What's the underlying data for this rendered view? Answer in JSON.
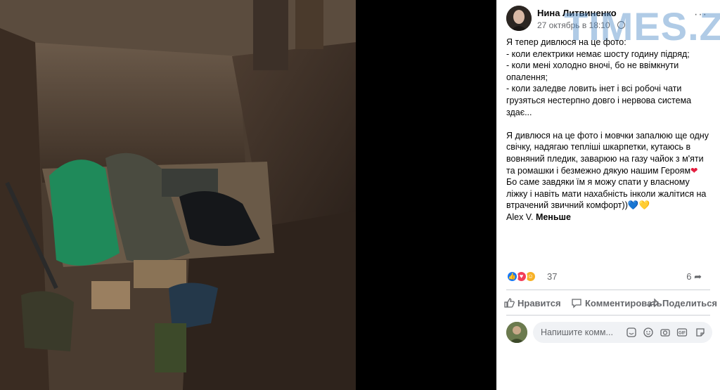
{
  "post": {
    "author": "Нина Литвиненко",
    "timestamp": "27 октябрь в 18:10",
    "watermark": "TIMES.ZT",
    "more_label": "···",
    "text_lines": [
      "Я тепер дивлюся на це фото:",
      "- коли електрики немає шосту годину підряд;",
      "- коли мені холодно вночі, бо не ввімкнути опалення;",
      "- коли заледве ловить інет і всі робочі чати грузяться нестерпно довго і нервова система здає..."
    ],
    "paragraph2": "Я дивлюся на це фото і мовчки запалюю ще одну свічку, надягаю тепліші шкарпетки, кутаюсь в вовняний пледик, заварюю на газу чайок з м'яти та ромашки і безмежно дякую нашим Героям",
    "paragraph2_heart": "❤",
    "paragraph2_rest": " Бо саме завдяки їм я можу спати у власному ліжку і навіть мати нахабність інколи жалітися на втрачений звичний комфорт))",
    "paragraph2_end_hearts": [
      "💙",
      "💛"
    ],
    "signature": "Alex V.",
    "less_label": "Меньше"
  },
  "reactions": {
    "count": "37",
    "shares": "6",
    "icons": [
      "like-icon",
      "love-icon",
      "care-icon"
    ],
    "colors": {
      "like": "#1877f2",
      "love": "#f33e58",
      "care": "#f7b125"
    }
  },
  "actions": {
    "like": "Нравится",
    "comment": "Комментировать",
    "share": "Поделиться"
  },
  "comment_box": {
    "placeholder": "Напишите комм...",
    "icons": [
      "sticker-icon",
      "emoji-icon",
      "camera-icon",
      "gif-icon",
      "sticker2-icon"
    ]
  },
  "colors": {
    "secondary_text": "#65676b",
    "divider": "#ced0d4",
    "input_bg": "#f0f2f5"
  }
}
